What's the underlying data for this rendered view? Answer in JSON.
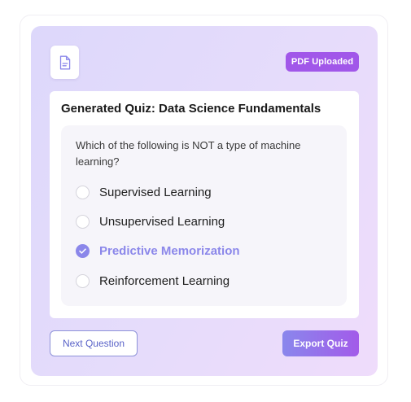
{
  "header": {
    "file_icon": "document-icon",
    "badge_label": "PDF Uploaded"
  },
  "quiz": {
    "title": "Generated Quiz: Data Science Fundamentals",
    "question": "Which of the following is NOT a type of machine learning?",
    "options": [
      {
        "label": "Supervised Learning",
        "selected": false
      },
      {
        "label": "Unsupervised Learning",
        "selected": false
      },
      {
        "label": "Predictive Memorization",
        "selected": true
      },
      {
        "label": "Reinforcement Learning",
        "selected": false
      }
    ]
  },
  "actions": {
    "next_label": "Next Question",
    "export_label": "Export Quiz"
  },
  "colors": {
    "accent": "#8b87ea",
    "badge": "#a157e9",
    "export_gradient_start": "#8a87ec",
    "export_gradient_end": "#a25be9"
  }
}
